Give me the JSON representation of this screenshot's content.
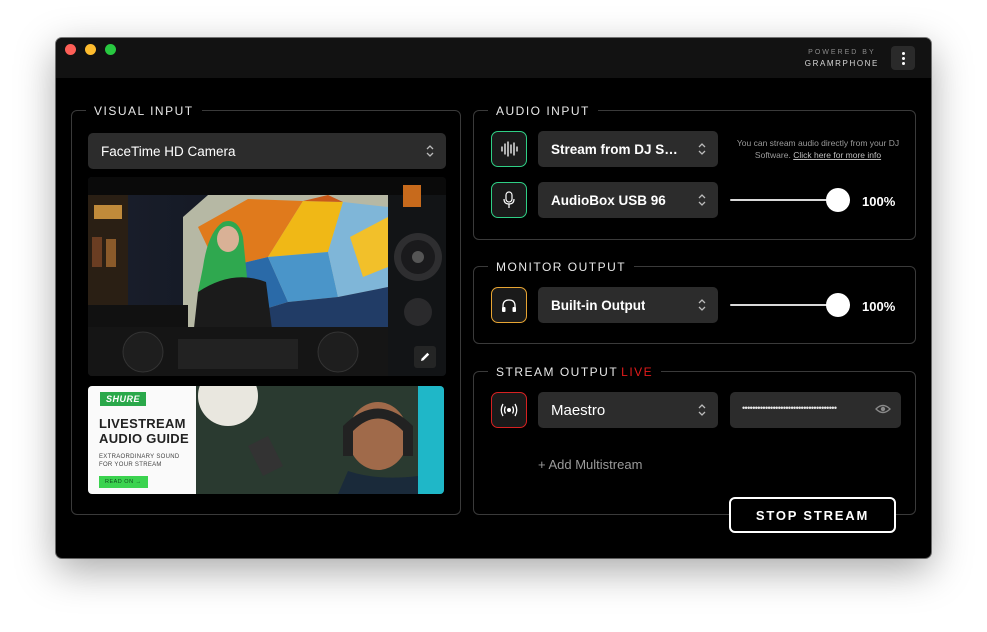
{
  "titlebar": {
    "powered_by": "POWERED BY",
    "brand": "GRAMRPHONE"
  },
  "visual_input": {
    "title": "VISUAL INPUT",
    "camera_select": "FaceTime HD Camera",
    "ad": {
      "brand": "SHURE",
      "title_line1": "LIVESTREAM",
      "title_line2": "AUDIO GUIDE",
      "subtitle_line1": "EXTRAORDINARY SOUND",
      "subtitle_line2": "FOR YOUR STREAM",
      "cta": "READ ON →"
    }
  },
  "audio_input": {
    "title": "AUDIO INPUT",
    "source_select": "Stream from DJ Software",
    "note_text": "You can stream audio directly from your DJ Software.",
    "note_link": "Click here for more info",
    "mic_select": "AudioBox USB 96",
    "mic_volume_label": "100%",
    "mic_volume": 1.0
  },
  "monitor_output": {
    "title": "MONITOR OUTPUT",
    "device_select": "Built-in Output",
    "volume_label": "100%",
    "volume": 1.0
  },
  "stream_output": {
    "title": "STREAM OUTPUT",
    "status": "LIVE",
    "destination_select": "Maestro",
    "stream_key_masked": "•••••••••••••••••••••••••••••••••••••",
    "add_multistream": "+ Add Multistream",
    "stop_button": "STOP STREAM"
  },
  "colors": {
    "accent_green": "#2fcf85",
    "accent_orange": "#e8a533",
    "accent_red": "#d62121",
    "live_red": "#e21b1b"
  }
}
